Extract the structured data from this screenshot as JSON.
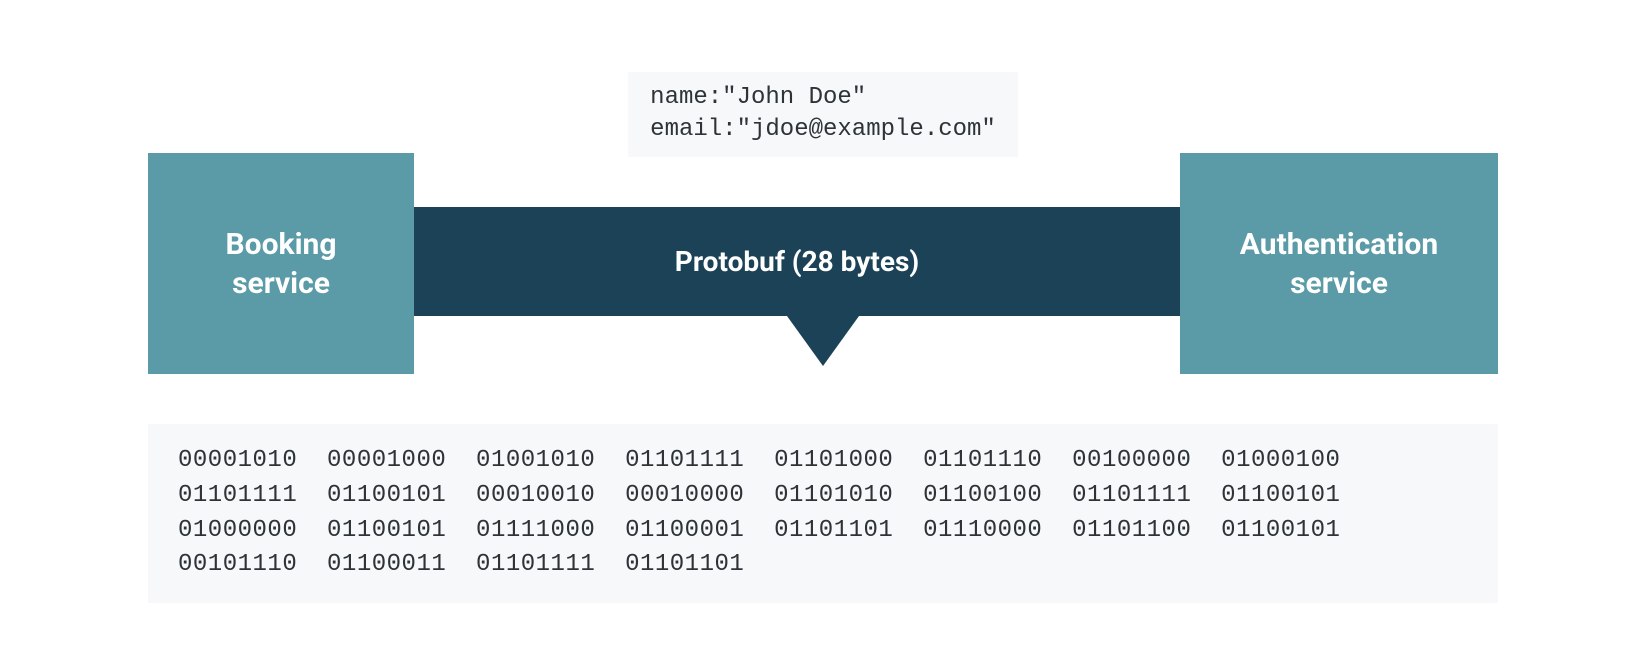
{
  "topData": {
    "line1": "name:\"John Doe\"",
    "line2": "email:\"jdoe@example.com\""
  },
  "services": {
    "left": "Booking\nservice",
    "right": "Authentication\nservice"
  },
  "middleBar": {
    "label": "Protobuf (28 bytes)"
  },
  "binary": {
    "row1": "00001010  00001000  01001010  01101111  01101000  01101110  00100000  01000100",
    "row2": "01101111  01100101  00010010  00010000  01101010  01100100  01101111  01100101",
    "row3": "01000000  01100101  01111000  01100001  01101101  01110000  01101100  01100101",
    "row4": "00101110  01100011  01101111  01101101"
  },
  "colors": {
    "serviceBox": "#5b9aa7",
    "middleBar": "#1b4256",
    "codeBg": "#f6f8fa",
    "codeText": "#2e3338"
  }
}
